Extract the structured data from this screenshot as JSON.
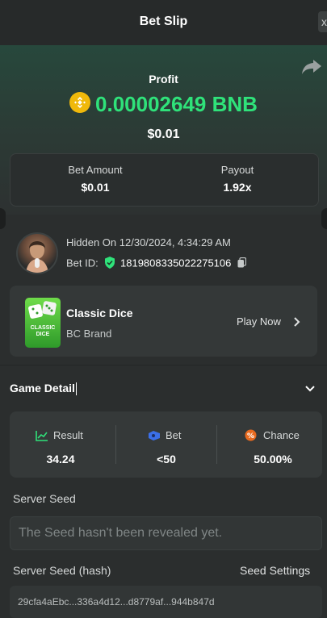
{
  "header": {
    "title": "Bet Slip",
    "close_label": "x"
  },
  "profit": {
    "label": "Profit",
    "amount": "0.00002649 BNB",
    "usd": "$0.01",
    "currency_icon": "bnb-coin-icon",
    "accent_color": "#2fe27a"
  },
  "stats": {
    "bet_amount_label": "Bet Amount",
    "bet_amount_value": "$0.01",
    "payout_label": "Payout",
    "payout_value": "1.92x"
  },
  "user": {
    "hidden_on": "Hidden On 12/30/2024, 4:34:29 AM",
    "bet_id_label": "Bet ID:",
    "bet_id_value": "1819808335022275106"
  },
  "game": {
    "name": "Classic Dice",
    "brand": "BC Brand",
    "play_label": "Play Now",
    "thumb_text": "CLASSIC DICE"
  },
  "game_detail": {
    "title": "Game Detail",
    "result_label": "Result",
    "result_value": "34.24",
    "bet_label": "Bet",
    "bet_value": "<50",
    "chance_label": "Chance",
    "chance_value": "50.00%"
  },
  "seeds": {
    "server_seed_label": "Server Seed",
    "server_seed_placeholder": "The Seed hasn't been revealed yet.",
    "server_seed_hash_label": "Server Seed (hash)",
    "seed_settings_label": "Seed Settings",
    "hash_value": "29cfa4aEbc...336a4d12...d8779af...944b847d"
  },
  "colors": {
    "background": "#2b2e2e",
    "card": "#343838",
    "profit_green": "#2fe27a",
    "coin_gold": "#f0b90b"
  }
}
